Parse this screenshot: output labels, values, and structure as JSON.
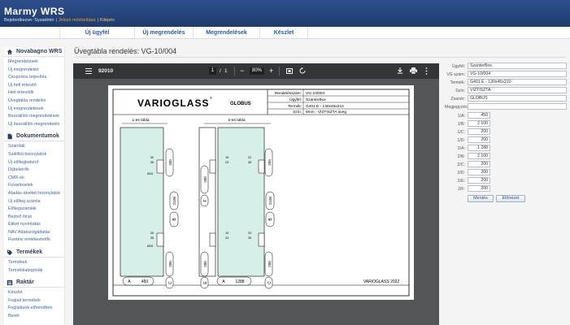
{
  "header": {
    "logo": "Marmy WRS",
    "user_prefix": "Bejelentkezve: Sysadmin",
    "password_change": "Jelszó módosítása",
    "logout": "Kilépés",
    "separator": "|",
    "bg_color": "#23407a"
  },
  "topnav": [
    "Új ügyfél",
    "Új megrendelés",
    "Megrendelések",
    "Készlet"
  ],
  "sidebar": {
    "groups": [
      {
        "title": "Novabagno WRS",
        "icon": "home-icon",
        "items": [
          "Megrendelések",
          "Új megrendelés",
          "Csoportos teljesítés",
          "Új heti értesítő",
          "Heti értesítők",
          "Üvegtábla rendelés",
          "Új megrendelések",
          "Beszállítói megrendelések",
          "Új beszállítói megrendelés"
        ]
      },
      {
        "title": "Dokumentumok",
        "icon": "document-icon",
        "items": [
          "Számlák",
          "Szállítói bizonylatok",
          "Új előlegbekérő",
          "Díjbekérők",
          "CMR-ek",
          "Fuvarlevelek",
          "Átadás-átvételi bizonylatok",
          "Új előleg számla",
          "Előlegszámlák",
          "Bejövő fizuk",
          "Etiket nyomtatás",
          "NAV Adatszolgáltatás",
          "Fizetési emlékeztetők"
        ]
      },
      {
        "title": "Termékek",
        "icon": "tag-icon",
        "items": [
          "Termékek",
          "Termékkategóriák"
        ]
      },
      {
        "title": "Raktár",
        "icon": "warehouse-icon",
        "items": [
          "Készlet",
          "Foglalt termékek",
          "Foglalások előrendben",
          "Bevét"
        ]
      }
    ]
  },
  "main": {
    "title": "Üvegtábla rendelés: VG-10/004"
  },
  "pdf": {
    "doc_title": "92010",
    "page_current": "1",
    "page_sep": "/",
    "page_total": "1",
    "zoom": "80%",
    "zoom_minus": "−",
    "zoom_plus": "+",
    "menu_icon": "menu-icon",
    "download_icon": "download-icon",
    "print_icon": "print-icon",
    "more_icon": "more-icon"
  },
  "drawing": {
    "brand": "VARIOGLASS",
    "brand_mark": "®",
    "client": "GLOBUS",
    "info_rows": [
      {
        "label": "Rendelésszám:",
        "value": "VG-10/004"
      },
      {
        "label": "Ügyfél:",
        "value": "SzanterBox"
      },
      {
        "label": "Termék:",
        "value": "G401 E - 130x45x210"
      },
      {
        "label": "Szín:",
        "value": "8mm - VÍZTISZTA üveg"
      }
    ],
    "panel1_title": "1-es tábla",
    "panel2_title": "2-es tábla",
    "dims": {
      "h1": "200",
      "h2": "2100",
      "h3": "200",
      "d30": "30",
      "d35": "35",
      "d20": "Ø20",
      "d22": "22",
      "d19": "19",
      "d23": "23"
    },
    "letters": {
      "a": "A",
      "b": "B",
      "c": "C",
      "d": "D",
      "e": "E",
      "f": "F"
    },
    "width1": "450",
    "width2": "1288",
    "footer": "VARIOGLASS 2022",
    "glass_color": "#d6efe9"
  },
  "form": {
    "fields": [
      {
        "label": "Ügyfél:",
        "value": "SzanterBox"
      },
      {
        "label": "VG szám:",
        "value": "VG-10/004"
      },
      {
        "label": "Termék:",
        "value": "G401 E - 130x45x210"
      },
      {
        "label": "Szín:",
        "value": "VÍZTISZTA"
      },
      {
        "label": "Zsanér:",
        "value": "GLOBUS"
      },
      {
        "label": "Megjegyzés:",
        "value": ""
      }
    ],
    "dims": [
      {
        "label": "1/A:",
        "value": "450"
      },
      {
        "label": "1/B:",
        "value": "2 100"
      },
      {
        "label": "1/C:",
        "value": "200"
      },
      {
        "label": "1/D:",
        "value": "200"
      },
      {
        "label": "2/A:",
        "value": "1 288"
      },
      {
        "label": "2/B:",
        "value": "2 100"
      },
      {
        "label": "2/C:",
        "value": "200"
      },
      {
        "label": "2/D:",
        "value": "200"
      },
      {
        "label": "2/E:",
        "value": "200"
      },
      {
        "label": "2/F:",
        "value": "200"
      }
    ],
    "save_label": "Mentés",
    "preview_label": "Előnézet"
  }
}
